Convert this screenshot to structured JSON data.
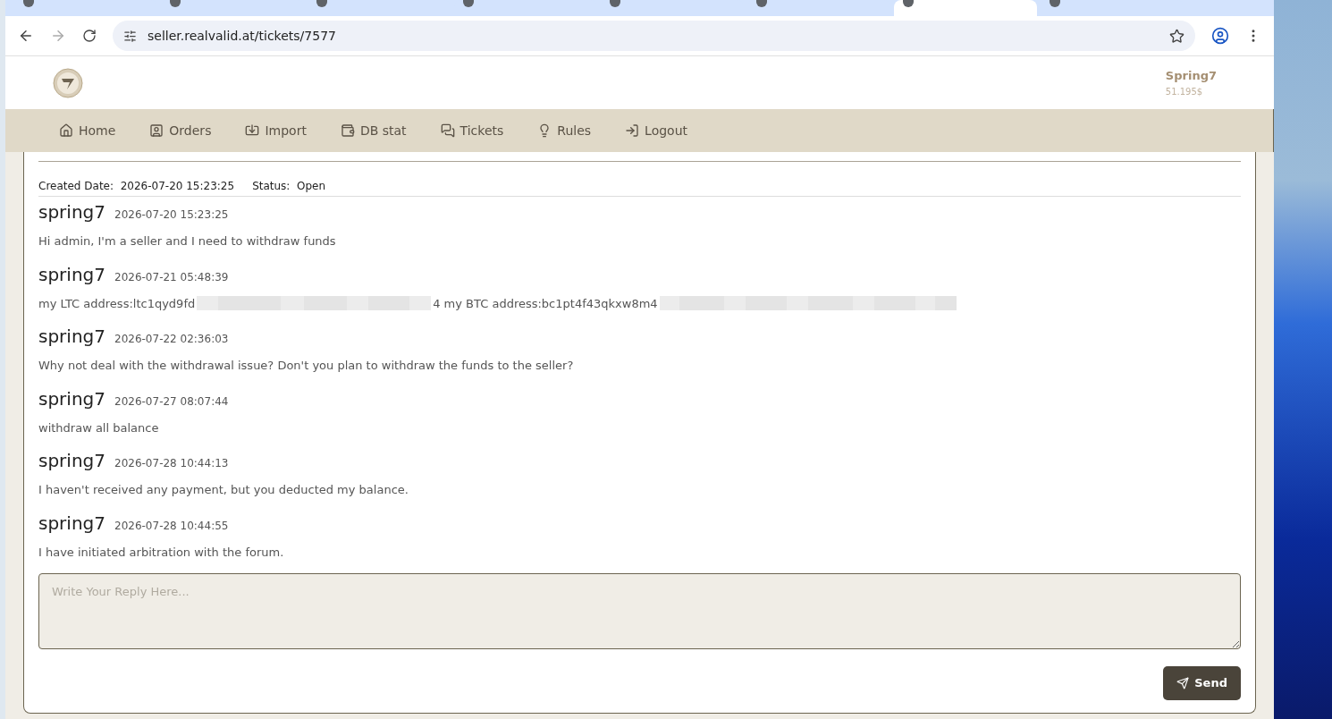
{
  "browser": {
    "url": "seller.realvalid.at/tickets/7577",
    "tabs": [
      {
        "selected": false
      },
      {
        "selected": false
      },
      {
        "selected": false
      },
      {
        "selected": false
      },
      {
        "selected": false
      },
      {
        "selected": false
      },
      {
        "selected": true
      },
      {
        "selected": false
      }
    ]
  },
  "header": {
    "username": "Spring7",
    "balance": "51.195$"
  },
  "nav": [
    {
      "label": "Home"
    },
    {
      "label": "Orders"
    },
    {
      "label": "Import"
    },
    {
      "label": "DB stat"
    },
    {
      "label": "Tickets"
    },
    {
      "label": "Rules"
    },
    {
      "label": "Logout"
    }
  ],
  "ticket": {
    "created_label": "Created Date:",
    "created": "2026-07-20 15:23:25",
    "status_label": "Status:",
    "status": "Open"
  },
  "messages": [
    {
      "author": "spring7",
      "time": "2026-07-20 15:23:25",
      "kind": "text",
      "parts": [
        "Hi admin, I'm a seller and I need to withdraw funds"
      ]
    },
    {
      "author": "spring7",
      "time": "2026-07-21 05:48:39",
      "kind": "redacted",
      "parts": [
        "my LTC address:ltc1qyd9fd",
        "4 my BTC address:bc1pt4f43qkxw8m4"
      ]
    },
    {
      "author": "spring7",
      "time": "2026-07-22 02:36:03",
      "kind": "text",
      "parts": [
        "Why not deal with the withdrawal issue? Don't you plan to withdraw the funds to the seller?"
      ]
    },
    {
      "author": "spring7",
      "time": "2026-07-27 08:07:44",
      "kind": "text",
      "parts": [
        "withdraw all balance"
      ]
    },
    {
      "author": "spring7",
      "time": "2026-07-28 10:44:13",
      "kind": "text",
      "parts": [
        "I haven't received any payment, but you deducted my balance."
      ]
    },
    {
      "author": "spring7",
      "time": "2026-07-28 10:44:55",
      "kind": "text",
      "parts": [
        "I have initiated arbitration with the forum."
      ]
    }
  ],
  "reply": {
    "placeholder": "Write Your Reply Here...",
    "send": "Send"
  }
}
